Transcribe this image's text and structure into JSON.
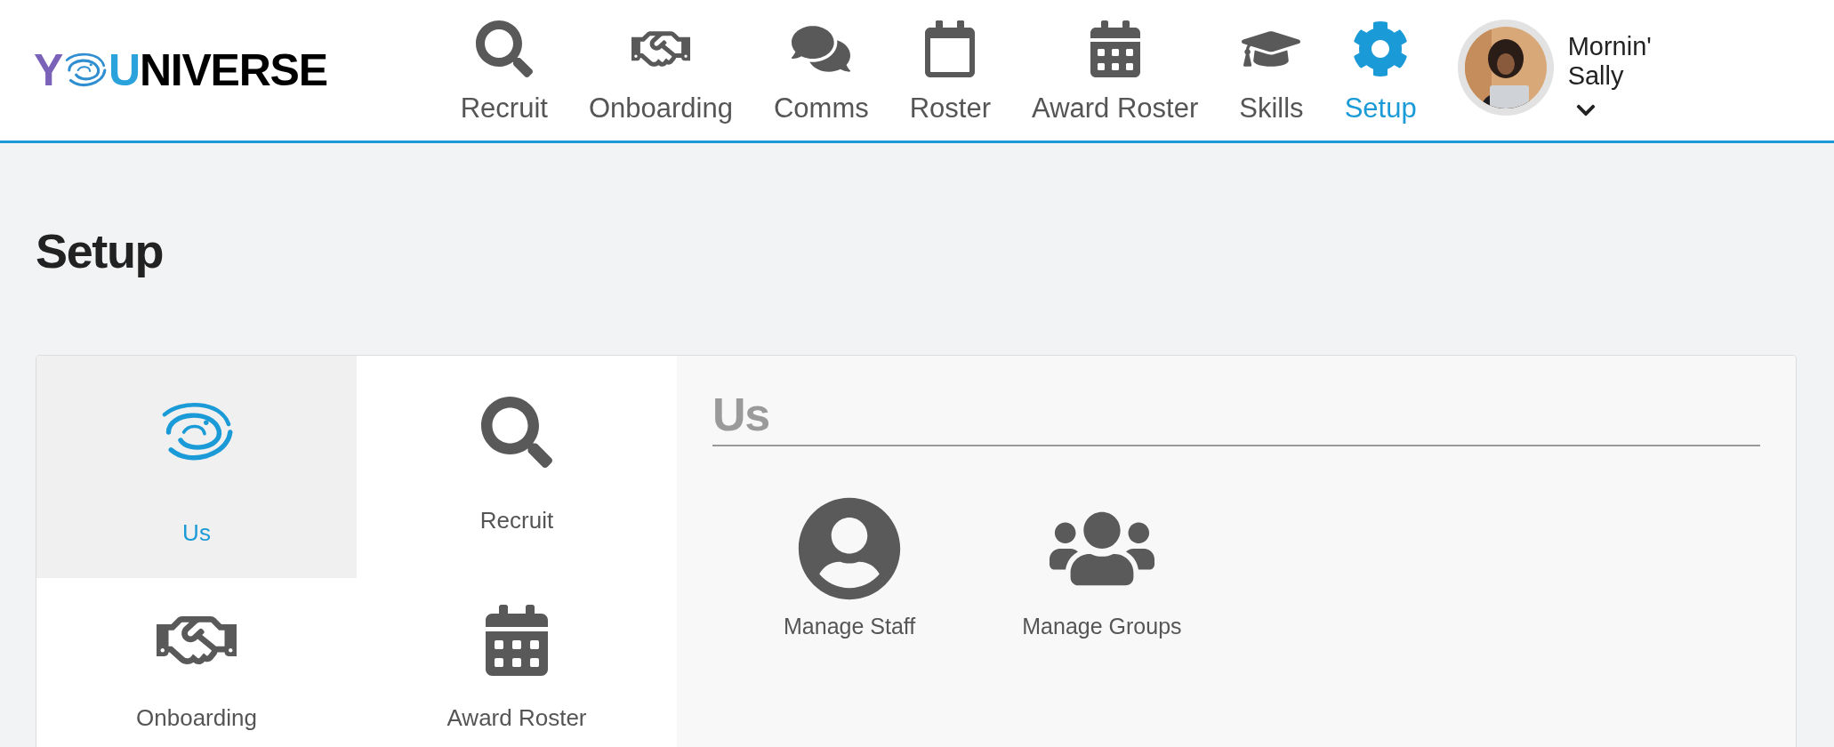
{
  "logo": {
    "lead": "Y",
    "accent": "U",
    "rest": "NIVERSE"
  },
  "nav": [
    {
      "label": "Recruit",
      "kind": "search",
      "selected": false
    },
    {
      "label": "Onboarding",
      "kind": "handshake",
      "selected": false
    },
    {
      "label": "Comms",
      "kind": "comments",
      "selected": false
    },
    {
      "label": "Roster",
      "kind": "calendar",
      "selected": false
    },
    {
      "label": "Award Roster",
      "kind": "calendar-grid",
      "selected": false
    },
    {
      "label": "Skills",
      "kind": "cap",
      "selected": false
    },
    {
      "label": "Setup",
      "kind": "gear",
      "selected": true
    }
  ],
  "user": {
    "greeting": "Mornin'",
    "name": "Sally"
  },
  "page_title": "Setup",
  "tiles": [
    {
      "label": "Us",
      "kind": "swirl",
      "selected": true
    },
    {
      "label": "Recruit",
      "kind": "search",
      "selected": false
    },
    {
      "label": "Onboarding",
      "kind": "handshake",
      "selected": false
    },
    {
      "label": "Award Roster",
      "kind": "calendar-grid",
      "selected": false
    }
  ],
  "panel": {
    "title": "Us",
    "actions": [
      {
        "label": "Manage Staff",
        "kind": "user"
      },
      {
        "label": "Manage Groups",
        "kind": "users"
      }
    ]
  }
}
